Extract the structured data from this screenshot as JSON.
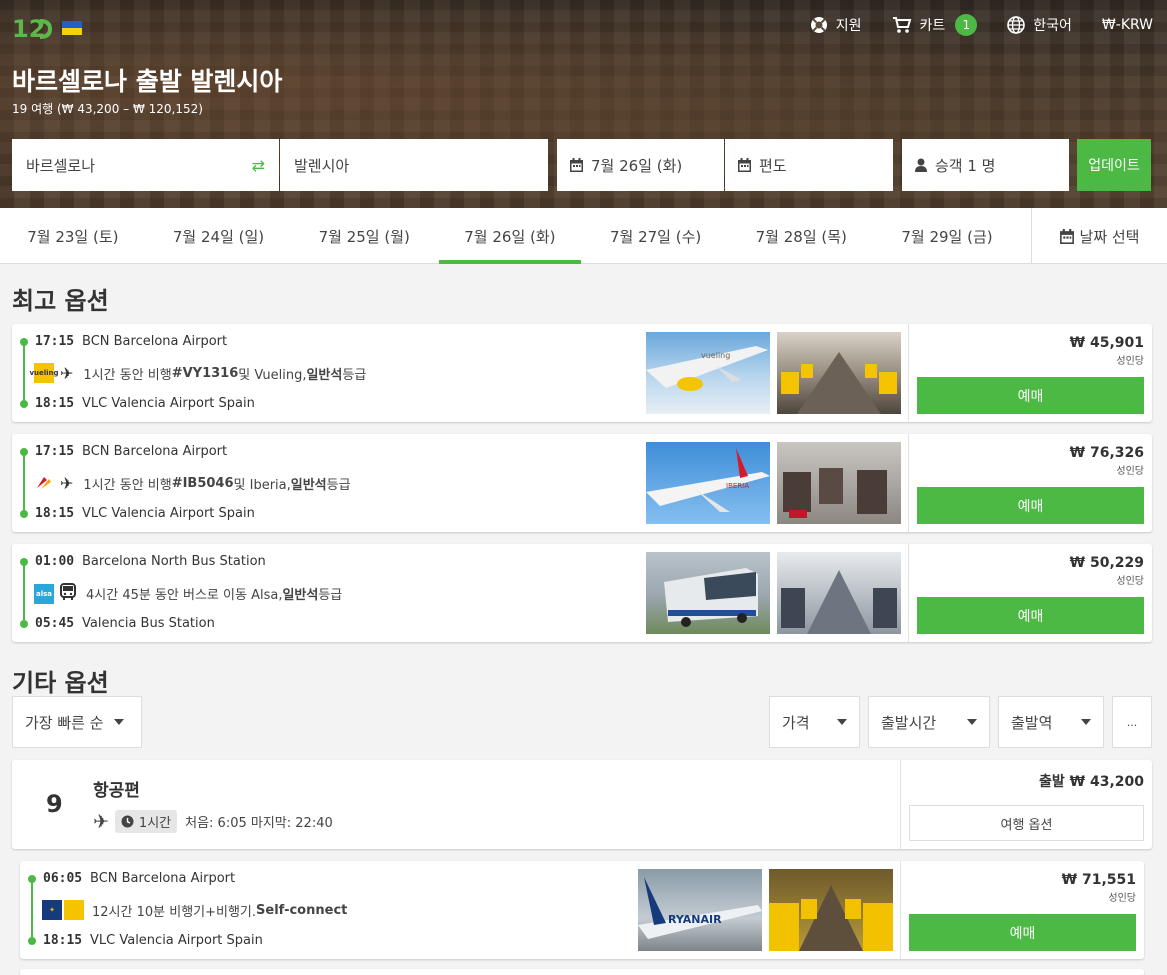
{
  "header": {
    "flag_colors": [
      "#1e60c8",
      "#f5d10a"
    ],
    "logo_icon": "12go-logo",
    "support_label": "지원",
    "cart_label": "카트",
    "cart_count": "1",
    "language_label": "한국어",
    "currency_label": "₩-KRW"
  },
  "hero": {
    "title": "바르셀로나 출발 발렌시아",
    "subtitle": "19 여행 (₩ 43,200 – ₩ 120,152)"
  },
  "search": {
    "from": "바르셀로나",
    "to": "발렌시아",
    "date": "7월 26일 (화)",
    "trip_type": "편도",
    "passengers": "승객 1 명",
    "update_label": "업데이트"
  },
  "date_tabs": [
    {
      "label": "7월 23일 (토)"
    },
    {
      "label": "7월 24일 (일)"
    },
    {
      "label": "7월 25일 (월)"
    },
    {
      "label": "7월 26일 (화)",
      "active": true
    },
    {
      "label": "7월 27일 (수)"
    },
    {
      "label": "7월 28일 (목)"
    },
    {
      "label": "7월 29일 (금)"
    }
  ],
  "date_pick_label": "날짜 선택",
  "best": {
    "heading": "최고 옵션",
    "results": [
      {
        "dep_time": "17:15",
        "dep_station": "BCN Barcelona Airport",
        "arr_time": "18:15",
        "arr_station": "VLC Valencia Airport Spain",
        "desc_pre": "1시간 동안 비행 ",
        "code": "#VY1316",
        "desc_mid": " 및 Vueling, ",
        "cls": "일반석",
        "desc_post": "등급",
        "carrier": "vueling",
        "carrier_color": "#f5c400",
        "mode_icon": "plane-icon",
        "price": "₩ 45,901",
        "per": "성인당",
        "buy_label": "예매"
      },
      {
        "dep_time": "17:15",
        "dep_station": "BCN Barcelona Airport",
        "arr_time": "18:15",
        "arr_station": "VLC Valencia Airport Spain",
        "desc_pre": "1시간 동안 비행 ",
        "code": "#IB5046",
        "desc_mid": " 및 Iberia, ",
        "cls": "일반석",
        "desc_post": "등급",
        "carrier": "",
        "carrier_color": "#d7192d",
        "mode_icon": "plane-icon",
        "price": "₩ 76,326",
        "per": "성인당",
        "buy_label": "예매"
      },
      {
        "dep_time": "01:00",
        "dep_station": "Barcelona North Bus Station",
        "arr_time": "05:45",
        "arr_station": "Valencia Bus Station",
        "desc_pre": "4시간 45분 동안 버스로 이동 Alsa, ",
        "code": "",
        "desc_mid": "",
        "cls": "일반석",
        "desc_post": " 등급",
        "carrier": "alsa",
        "carrier_color": "#2aa7d9",
        "mode_icon": "bus-icon",
        "price": "₩ 50,229",
        "per": "성인당",
        "buy_label": "예매"
      }
    ]
  },
  "other": {
    "heading": "기타 옵션",
    "sort_label": "가장 빠른 순",
    "filters": [
      "가격",
      "출발시간",
      "출발역"
    ],
    "more_label": "...",
    "group": {
      "count": "9",
      "title": "항공편",
      "duration": "1시간",
      "range": "처음: 6:05 마지막: 22:40",
      "price": "출발 ₩ 43,200",
      "options_label": "여행 옵션"
    },
    "result": {
      "dep_time": "06:05",
      "dep_station": "BCN Barcelona Airport",
      "arr_time": "18:15",
      "arr_station": "VLC Valencia Airport Spain",
      "desc": "12시간 10분 비행기+비행기. ",
      "desc_bold": "Self-connect",
      "carriers": [
        "ryanair",
        "vueling"
      ],
      "price": "₩ 71,551",
      "per": "성인당",
      "buy_label": "예매"
    }
  },
  "accent_color": "#4cb944"
}
